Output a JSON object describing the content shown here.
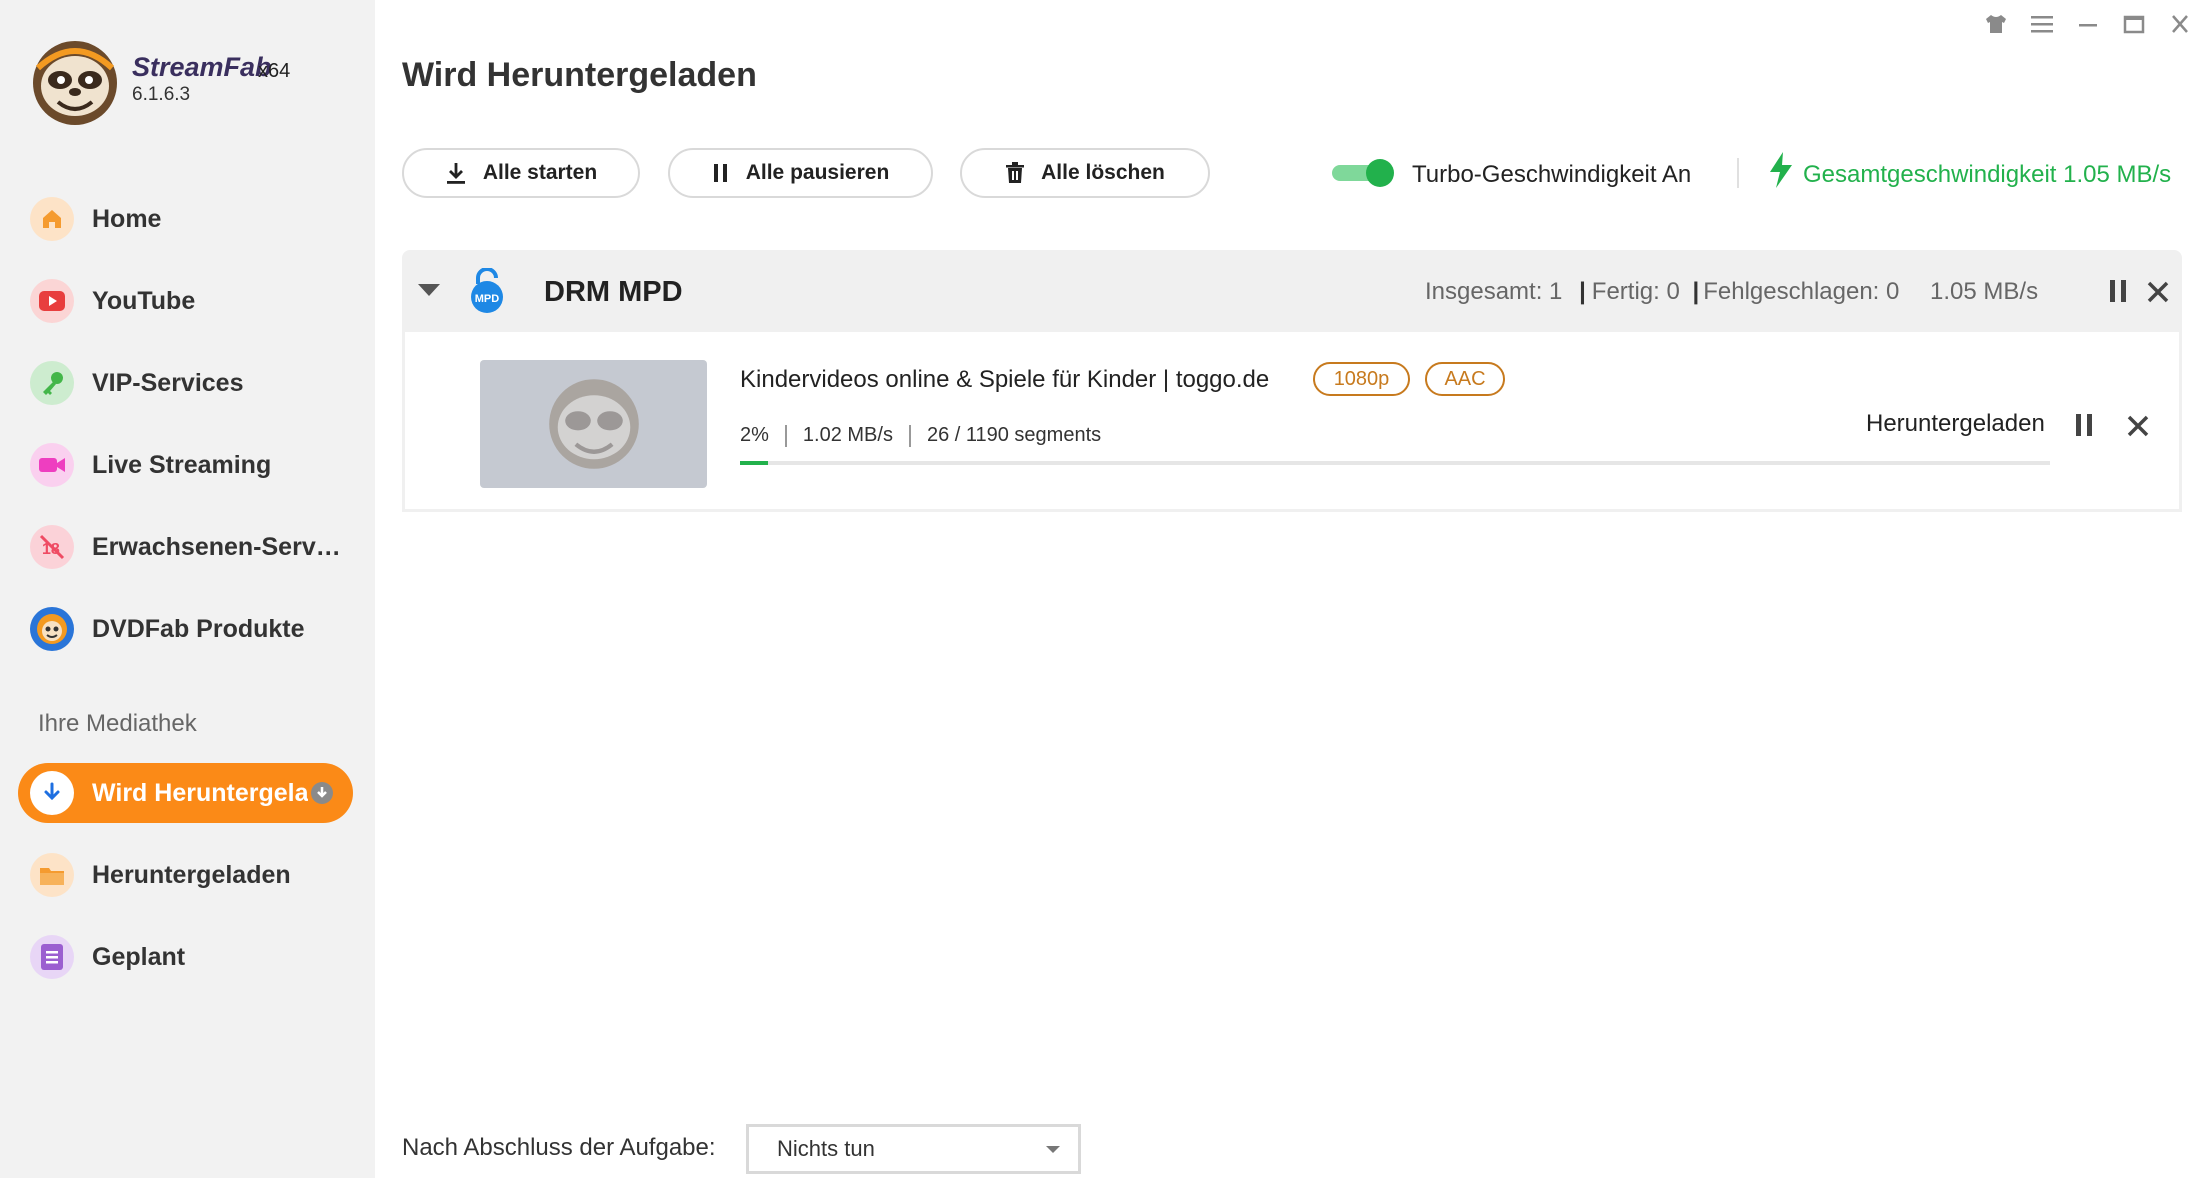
{
  "app": {
    "brand": "StreamFab",
    "arch": "x64",
    "version": "6.1.6.3"
  },
  "sidebar": {
    "items": [
      {
        "label": "Home",
        "icon": "home-icon",
        "color": "#f59b2f"
      },
      {
        "label": "YouTube",
        "icon": "youtube-icon",
        "color": "#e83e3e"
      },
      {
        "label": "VIP-Services",
        "icon": "key-icon",
        "color": "#43b649"
      },
      {
        "label": "Live Streaming",
        "icon": "camera-icon",
        "color": "#ee3ec0"
      },
      {
        "label": "Erwachsenen-Serv…",
        "icon": "adult-icon",
        "color": "#ef4b63"
      },
      {
        "label": "DVDFab Produkte",
        "icon": "dvdfab-icon",
        "color": "#2a75d8"
      }
    ],
    "section_title": "Ihre Mediathek",
    "library": [
      {
        "label": "Wird Heruntergela",
        "icon": "download-icon",
        "active": true
      },
      {
        "label": "Heruntergeladen",
        "icon": "folder-icon",
        "color": "#f59b2f"
      },
      {
        "label": "Geplant",
        "icon": "list-icon",
        "color": "#9b5fd0"
      }
    ]
  },
  "main": {
    "title": "Wird Heruntergeladen",
    "toolbar": {
      "start_all": "Alle starten",
      "pause_all": "Alle pausieren",
      "delete_all": "Alle löschen"
    },
    "turbo": {
      "label": "Turbo-Geschwindigkeit An",
      "on": true
    },
    "total_speed": "Gesamtgeschwindigkeit 1.05 MB/s",
    "accent_color": "#22b14c",
    "group": {
      "title": "DRM MPD",
      "total": "Insgesamt: 1",
      "done": "Fertig: 0",
      "failed": "Fehlgeschlagen: 0",
      "speed": "1.05 MB/s",
      "item": {
        "title": "Kindervideos online & Spiele für Kinder | toggo.de",
        "badges": [
          "1080p",
          "AAC"
        ],
        "percent": "2%",
        "progress": 0.02,
        "speed": "1.02 MB/s",
        "segments": "26 / 1190 segments",
        "status": "Heruntergeladen"
      }
    },
    "footer": {
      "after_label": "Nach Abschluss der Aufgabe:",
      "after_value": "Nichts tun"
    }
  }
}
